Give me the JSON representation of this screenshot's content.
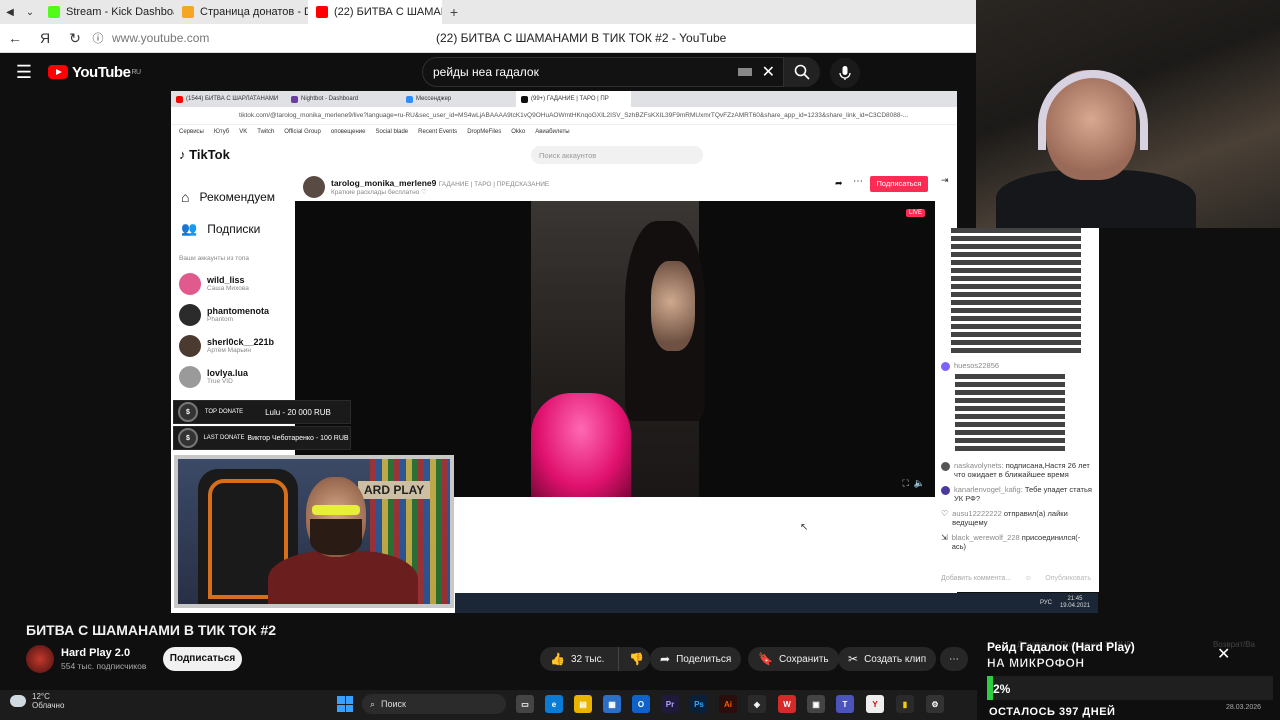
{
  "browser": {
    "tabs": [
      {
        "label": "Stream - Kick Dashboard",
        "color": "#53fc18"
      },
      {
        "label": "Страница донатов - Donat",
        "color": "#f5a623"
      },
      {
        "label": "(22) БИТВА С ШАМАН",
        "color": "#ff0000",
        "active": true
      }
    ],
    "url": "www.youtube.com",
    "page_title": "(22) БИТВА С ШАМАНАМИ В ТИК ТОК #2 - YouTube"
  },
  "youtube": {
    "logo": "YouTube",
    "region": "RU",
    "search_value": "рейды неа гадалок"
  },
  "inner_browser": {
    "tabs": [
      "(1544) БИТВА С ШАРЛАТАНАМИ",
      "Nightbot - Dashboard",
      "Мессенджер",
      "(99+) ГАДАНИЕ | ТАРО | ПР"
    ],
    "url": "tiktok.com/@tarolog_monika_merlene9/live?language=ru-RU&sec_user_id=MS4wLjABAAAA9tcK1vQ9OHuAOWmtHKnqoGXIL2ISV_SzhBZFsKXIL39F9mRMUxmrTQvFZzAMRT60&share_app_id=1233&share_link_id=C3CD8088-...",
    "bookmarks": [
      "Сервисы",
      "Ютуб",
      "VK",
      "Twitch",
      "Official Group",
      "оповещение",
      "Social blade",
      "Recent Events",
      "DropMeFiles",
      "Okko",
      "Авиабилеты"
    ]
  },
  "tiktok": {
    "logo": "TikTok",
    "search_placeholder": "Поиск аккаунтов",
    "nav": [
      "Рекомендуем",
      "Подписки"
    ],
    "section_label": "Ваши аккаунты из топа",
    "accounts": [
      {
        "name": "wild_liss",
        "sub": "Саша Михова",
        "color": "#e05a8e"
      },
      {
        "name": "phantomenota",
        "sub": "Phantom",
        "color": "#2b2b2b"
      },
      {
        "name": "sherl0ck__221b",
        "sub": "Артём Марьин",
        "color": "#4a3a30"
      },
      {
        "name": "lovlya.lua",
        "sub": "True VID",
        "color": "#9a9a9a"
      }
    ],
    "streamer_name": "tarolog_monika_merlene9",
    "streamer_tags": "ГАДАНИЕ | ТАРО | ПРЕДСКАЗАНИЕ",
    "streamer_desc": "Краткие расклады бесплатно ♡",
    "follow_label": "Подписаться",
    "live_badge": "LIVE"
  },
  "chat": {
    "messages": [
      {
        "user": "huesos22856",
        "text": ""
      },
      {
        "user": "naskavolynets:",
        "text": "подписана,Настя 26 лет что ожидает в ближайшее время"
      },
      {
        "user": "kanarlenvogel_kafig:",
        "text": "Тебе упадет статья УК РФ?"
      },
      {
        "user": "ausu12222222",
        "text": "отправил(а) лайки ведущему"
      },
      {
        "user": "black_werewolf_228",
        "text": "присоединился(-ась)"
      }
    ],
    "input_placeholder": "Добавить коммента...",
    "send_label": "Опубликовать"
  },
  "donations": {
    "top_label": "TOP DONATE",
    "top_value": "Lulu - 20 000 RUB",
    "last_label": "LAST DONATE",
    "last_value": "Виктор Чеботаренко - 100 RUB"
  },
  "facecam_sign": "ARD PLAY",
  "inner_clock": {
    "time": "21:45",
    "date": "19.04.2021",
    "lang": "РУС"
  },
  "video": {
    "title": "БИТВА С ШАМАНАМИ В ТИК ТОК #2",
    "channel": "Hard Play 2.0",
    "subscribers": "554 тыс. подписчиков",
    "subscribe_label": "Подписаться",
    "likes": "32 тыс.",
    "share_label": "Поделиться",
    "save_label": "Сохранить",
    "clip_label": "Создать клип"
  },
  "goal_overlay": {
    "title": "Рейд Гадалок (Hard Play)",
    "subtitle": "НА МИКРОФОН",
    "percent": "2%",
    "fraction": 0.02,
    "days": "ОСТАЛОСЬ 397 ДНЕЙ",
    "ghost_left": "Донатеры / Последние 10 RUB",
    "ghost_right": "Возврат/Ва"
  },
  "taskbar": {
    "weather_temp": "12°C",
    "weather_desc": "Облачно",
    "search_placeholder": "Поиск",
    "date": "28.03.2026"
  }
}
